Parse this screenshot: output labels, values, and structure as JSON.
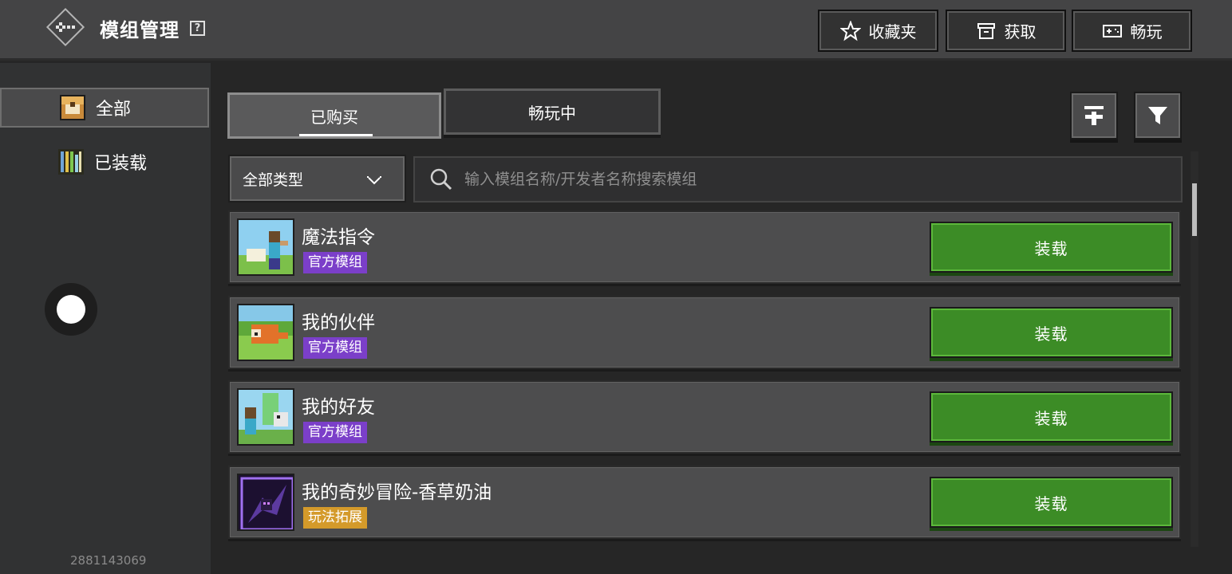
{
  "header": {
    "title": "模组管理",
    "help_glyph": "?",
    "buttons": [
      {
        "label": "收藏夹",
        "icon": "star-icon"
      },
      {
        "label": "获取",
        "icon": "store-icon"
      },
      {
        "label": "畅玩",
        "icon": "gamepad-icon"
      }
    ]
  },
  "sidebar": {
    "items": [
      {
        "label": "全部",
        "icon": "chest-icon",
        "active": true
      },
      {
        "label": "已装载",
        "icon": "bookshelf-icon",
        "active": false
      }
    ],
    "uid": "2881143069"
  },
  "tabs": [
    {
      "label": "已购买",
      "active": true
    },
    {
      "label": "畅玩中",
      "active": false
    }
  ],
  "toolbar": {
    "upload_icon": "upload-icon",
    "filter_icon": "filter-icon"
  },
  "filter": {
    "type_selected": "全部类型"
  },
  "search": {
    "placeholder": "输入模组名称/开发者名称搜索模组",
    "value": ""
  },
  "mods": [
    {
      "name": "魔法指令",
      "tag": "官方模组",
      "tag_type": "official",
      "action": "装载"
    },
    {
      "name": "我的伙伴",
      "tag": "官方模组",
      "tag_type": "official",
      "action": "装载"
    },
    {
      "name": "我的好友",
      "tag": "官方模组",
      "tag_type": "official",
      "action": "装载"
    },
    {
      "name": "我的奇妙冒险-香草奶油",
      "tag": "玩法拓展",
      "tag_type": "gameplay",
      "action": "装载"
    }
  ],
  "colors": {
    "load_button": "#3c8c26",
    "official_tag": "#7b3fc9",
    "gameplay_tag": "#d49a2a"
  }
}
